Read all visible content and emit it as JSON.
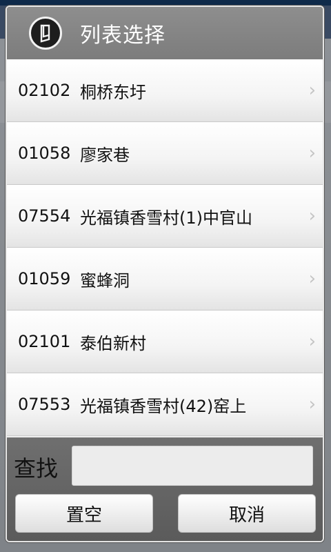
{
  "dialog": {
    "title": "列表选择",
    "icon": "bookmark-icon"
  },
  "items": [
    {
      "code": "02102",
      "name": "桐桥东圩"
    },
    {
      "code": "01058",
      "name": "廖家巷"
    },
    {
      "code": "07554",
      "name": "光福镇香雪村(1)中官山"
    },
    {
      "code": "01059",
      "name": "蜜蜂洞"
    },
    {
      "code": "02101",
      "name": "泰伯新村"
    },
    {
      "code": "07553",
      "name": "光福镇香雪村(42)窑上"
    }
  ],
  "search": {
    "label": "查找",
    "value": "",
    "placeholder": ""
  },
  "buttons": {
    "clear_label": "置空",
    "cancel_label": "取消"
  },
  "colors": {
    "title_bar": "#8e8e8e",
    "list_bg": "#efefef",
    "search_bg": "#5a5a5a"
  }
}
